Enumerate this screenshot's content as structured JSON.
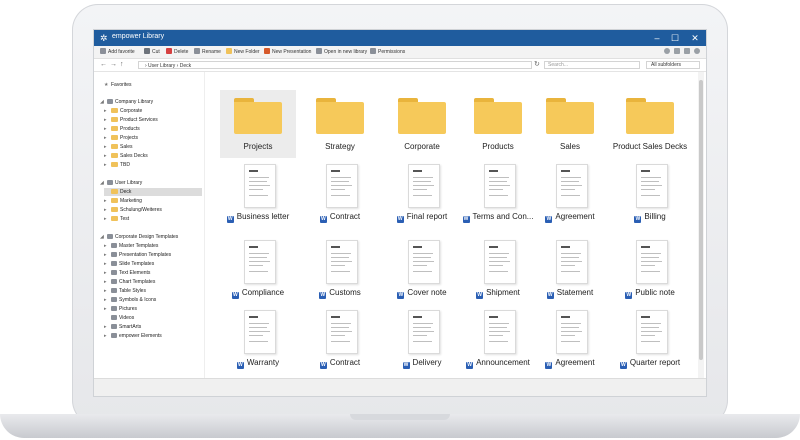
{
  "window": {
    "title": "empower Library"
  },
  "toolbar": {
    "add_favorite": "Add favorite",
    "cut": "Cut",
    "delete": "Delete",
    "rename": "Rename",
    "new_folder": "New Folder",
    "new_presentation": "New Presentation",
    "open_in_new_library": "Open in new library",
    "permissions": "Permissions"
  },
  "address": {
    "breadcrumb": "›  User Library  ›  Deck",
    "search_placeholder": "Search...",
    "scope": "All subfolders"
  },
  "sidebar": {
    "favorites": "Favorites",
    "company_library": {
      "label": "Company Library",
      "children": [
        "Corporate",
        "Product Services",
        "Products",
        "Projects",
        "Sales",
        "Sales Decks",
        "TBD"
      ]
    },
    "user_library": {
      "label": "User Library",
      "children": [
        "Deck",
        "Marketing",
        "Schulung/Weiteres",
        "Test"
      ]
    },
    "templates": {
      "label": "Corporate Design Templates",
      "children": [
        "Master Templates",
        "Presentation Templates",
        "Slide Templates",
        "Text Elements",
        "Chart Templates",
        "Table Styles",
        "Symbols & Icons",
        "Pictures",
        "Videos",
        "SmartArts",
        "empower Elements"
      ]
    }
  },
  "content": {
    "folders": [
      "Projects",
      "Strategy",
      "Corporate",
      "Products",
      "Sales",
      "Product Sales Decks"
    ],
    "documents": [
      [
        "Business letter",
        "Contract",
        "Final report",
        "Terms and Con...",
        "Agreement",
        "Billing"
      ],
      [
        "Compliance",
        "Customs",
        "Cover note",
        "Shipment",
        "Statement",
        "Public note"
      ],
      [
        "Warranty",
        "Contract",
        "Delivery",
        "Announcement",
        "Agreement",
        "Quarter report"
      ]
    ],
    "word_glyph": "W"
  }
}
